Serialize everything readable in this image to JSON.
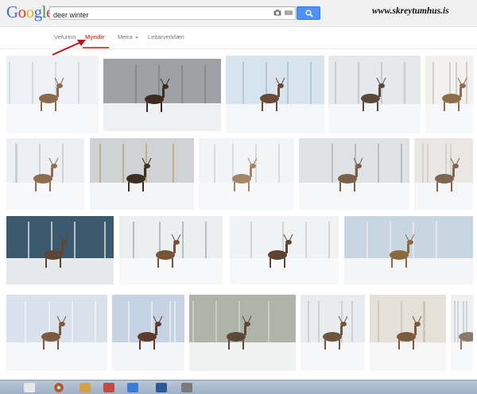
{
  "header": {
    "logo_letters": [
      {
        "ch": "G",
        "color": "#3b6fd6"
      },
      {
        "ch": "o",
        "color": "#dd3b2d"
      },
      {
        "ch": "o",
        "color": "#e5b20f"
      },
      {
        "ch": "g",
        "color": "#3b6fd6"
      },
      {
        "ch": "l",
        "color": "#2f9e3f"
      },
      {
        "ch": "e",
        "color": "#dd3b2d"
      }
    ],
    "search_value": "deer winter",
    "watermark": "www.skreytumhus.is"
  },
  "tabs": [
    {
      "label": "Vefurinn",
      "active": false
    },
    {
      "label": "Myndir",
      "active": true
    },
    {
      "label": "Meira",
      "active": false,
      "dropdown": true
    },
    {
      "label": "Leitarverkfæri",
      "active": false
    }
  ],
  "colors": {
    "accent": "#dd4b39",
    "search_button": "#4d90fe",
    "arrow": "#c0101a"
  },
  "results": [
    {
      "row": 1,
      "subject": "doe in snowy field"
    },
    {
      "row": 1,
      "subject": "stag head antlers close-up"
    },
    {
      "row": 1,
      "subject": "stag in snow"
    },
    {
      "row": 1,
      "subject": "deer in frosted forest"
    },
    {
      "row": 1,
      "subject": "buck beside birch tree"
    },
    {
      "row": 2,
      "subject": "two deer in snow"
    },
    {
      "row": 2,
      "subject": "herd at foggy meadow"
    },
    {
      "row": 2,
      "subject": "whitetail deer among birches"
    },
    {
      "row": 2,
      "subject": "group of deer in winter woods"
    },
    {
      "row": 2,
      "subject": "deer faces close-up"
    },
    {
      "row": 3,
      "subject": "elk grazing in snowy pines"
    },
    {
      "row": 3,
      "subject": "deer in snowy thicket"
    },
    {
      "row": 3,
      "subject": "spotted deer in snow"
    },
    {
      "row": 3,
      "subject": "buck on fallen log"
    },
    {
      "row": 4,
      "subject": "doe under winter tree"
    },
    {
      "row": 4,
      "subject": "stag in snowy field"
    },
    {
      "row": 4,
      "subject": "buck in misty forest"
    },
    {
      "row": 4,
      "subject": "deer in snow by fence"
    },
    {
      "row": 4,
      "subject": "buck painting"
    },
    {
      "row": 4,
      "subject": "snowy tree edge"
    }
  ]
}
